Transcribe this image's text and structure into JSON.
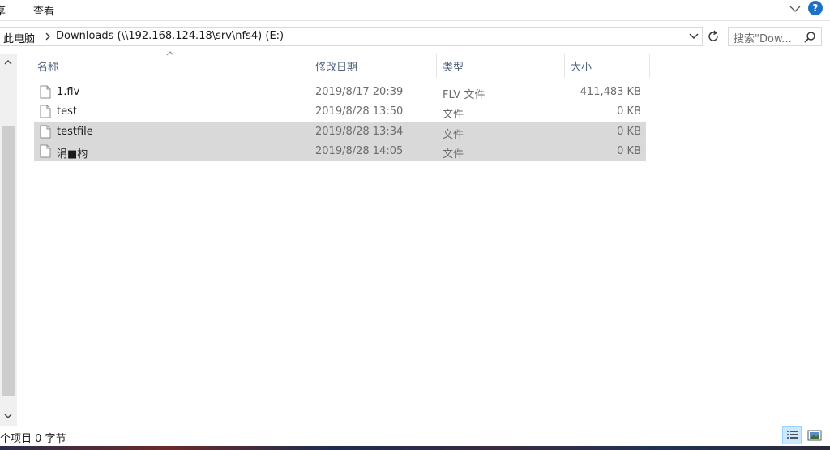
{
  "ribbon": {
    "tabs": [
      "享",
      "查看"
    ],
    "help_glyph": "?"
  },
  "address": {
    "root": "此电脑",
    "current": "Downloads (\\\\192.168.124.18\\srv\\nfs4) (E:)"
  },
  "search": {
    "placeholder": "搜索\"Dow..."
  },
  "columns": {
    "name": "名称",
    "date": "修改日期",
    "type": "类型",
    "size": "大小"
  },
  "files": [
    {
      "name": "1.flv",
      "date": "2019/8/17 20:39",
      "type": "FLV 文件",
      "size": "411,483 KB",
      "selected": false
    },
    {
      "name": "test",
      "date": "2019/8/28 13:50",
      "type": "文件",
      "size": "0 KB",
      "selected": false
    },
    {
      "name": "testfile",
      "date": "2019/8/28 13:34",
      "type": "文件",
      "size": "0 KB",
      "selected": true
    },
    {
      "name": "涓■枃",
      "date": "2019/8/28 14:05",
      "type": "文件",
      "size": "0 KB",
      "selected": true
    }
  ],
  "status": {
    "text": "个项目 0 字节"
  },
  "icons": {
    "help": "help-icon",
    "expand": "chevron-down-icon",
    "refresh": "refresh-icon",
    "search": "search-icon",
    "file": "file-icon"
  },
  "colors": {
    "accent": "#1d71c6",
    "selection": "#d9d9d9",
    "header_text": "#4c607a"
  }
}
